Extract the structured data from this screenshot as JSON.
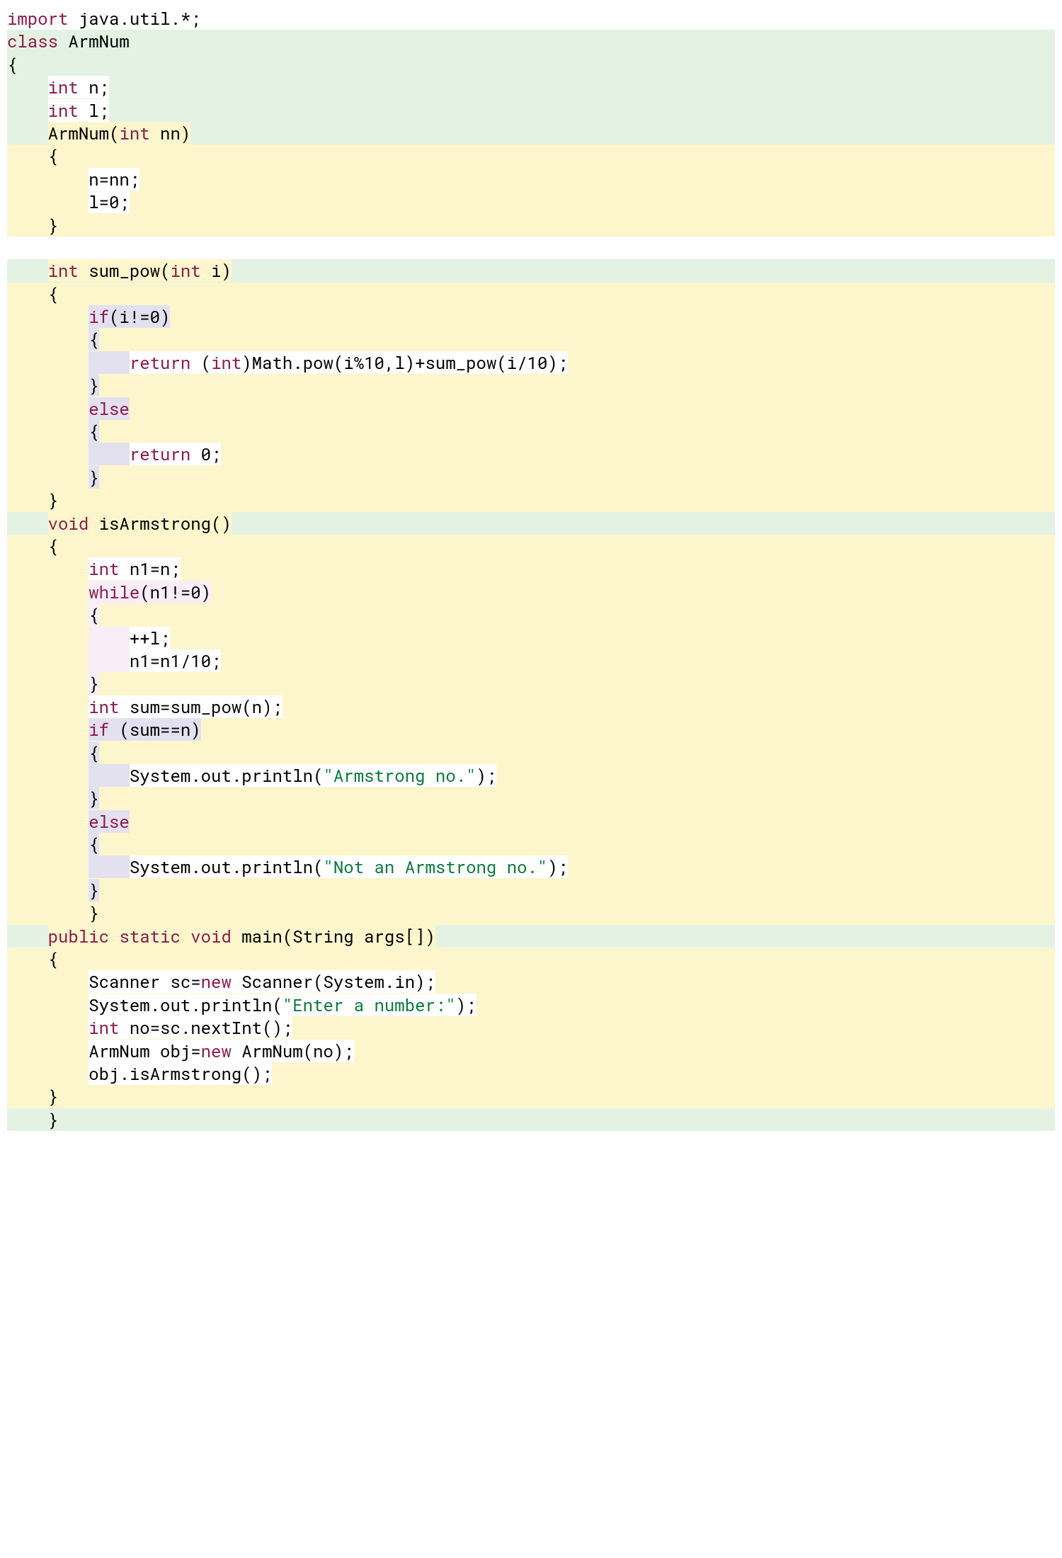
{
  "lines": [
    {
      "bg": "bg-white",
      "segs": [
        {
          "cls": "kw",
          "t": "import"
        },
        {
          "cls": "plain",
          "t": " java.util.*;"
        }
      ]
    },
    {
      "bg": "bg-green",
      "segs": [
        {
          "cls": "kw",
          "t": "class"
        },
        {
          "cls": "plain",
          "t": " ArmNum"
        }
      ]
    },
    {
      "bg": "bg-green",
      "segs": [
        {
          "cls": "plain",
          "t": "{"
        }
      ]
    },
    {
      "bg": "bg-green",
      "segs": [
        {
          "cls": "plain",
          "t": "    ",
          "bg": "bg-green"
        },
        {
          "cls": "kw",
          "t": "int",
          "bg": "bg-white"
        },
        {
          "cls": "plain",
          "t": " n;",
          "bg": "bg-white"
        }
      ]
    },
    {
      "bg": "bg-green",
      "segs": [
        {
          "cls": "plain",
          "t": "    ",
          "bg": "bg-green"
        },
        {
          "cls": "kw",
          "t": "int",
          "bg": "bg-white"
        },
        {
          "cls": "plain",
          "t": " l;",
          "bg": "bg-white"
        }
      ]
    },
    {
      "bg": "bg-green",
      "segs": [
        {
          "cls": "plain",
          "t": "    ",
          "bg": "bg-green"
        },
        {
          "cls": "plain",
          "t": "ArmNum(",
          "bg": "bg-yellow"
        },
        {
          "cls": "kw",
          "t": "int",
          "bg": "bg-yellow"
        },
        {
          "cls": "plain",
          "t": " nn)",
          "bg": "bg-yellow"
        }
      ]
    },
    {
      "bg": "bg-yellow",
      "segs": [
        {
          "cls": "plain",
          "t": "    {"
        }
      ]
    },
    {
      "bg": "bg-yellow",
      "segs": [
        {
          "cls": "plain",
          "t": "        ",
          "bg": "bg-yellow"
        },
        {
          "cls": "plain",
          "t": "n=nn;",
          "bg": "bg-white"
        }
      ]
    },
    {
      "bg": "bg-yellow",
      "segs": [
        {
          "cls": "plain",
          "t": "        ",
          "bg": "bg-yellow"
        },
        {
          "cls": "plain",
          "t": "l=0;",
          "bg": "bg-white"
        }
      ]
    },
    {
      "bg": "bg-yellow",
      "segs": [
        {
          "cls": "plain",
          "t": "    }"
        }
      ]
    },
    {
      "bg": "bg-white",
      "segs": [
        {
          "cls": "plain",
          "t": " "
        }
      ]
    },
    {
      "bg": "bg-green",
      "segs": [
        {
          "cls": "plain",
          "t": "    ",
          "bg": "bg-green"
        },
        {
          "cls": "kw",
          "t": "int",
          "bg": "bg-yellow"
        },
        {
          "cls": "plain",
          "t": " sum_pow(",
          "bg": "bg-yellow"
        },
        {
          "cls": "kw",
          "t": "int",
          "bg": "bg-yellow"
        },
        {
          "cls": "plain",
          "t": " i)",
          "bg": "bg-yellow"
        }
      ]
    },
    {
      "bg": "bg-yellow",
      "segs": [
        {
          "cls": "plain",
          "t": "    {"
        }
      ]
    },
    {
      "bg": "bg-yellow",
      "segs": [
        {
          "cls": "plain",
          "t": "        ",
          "bg": "bg-yellow"
        },
        {
          "cls": "kw",
          "t": "if",
          "bg": "bg-purple"
        },
        {
          "cls": "plain",
          "t": "(i!=0)",
          "bg": "bg-purple"
        }
      ]
    },
    {
      "bg": "bg-yellow",
      "segs": [
        {
          "cls": "plain",
          "t": "        ",
          "bg": "bg-yellow"
        },
        {
          "cls": "plain",
          "t": "{",
          "bg": "bg-purple"
        }
      ]
    },
    {
      "bg": "bg-yellow",
      "segs": [
        {
          "cls": "plain",
          "t": "        ",
          "bg": "bg-yellow"
        },
        {
          "cls": "plain",
          "t": "    ",
          "bg": "bg-purple"
        },
        {
          "cls": "kw",
          "t": "return",
          "bg": "bg-white"
        },
        {
          "cls": "plain",
          "t": " (",
          "bg": "bg-white"
        },
        {
          "cls": "kw",
          "t": "int",
          "bg": "bg-white"
        },
        {
          "cls": "plain",
          "t": ")Math.pow(i%10,l)+sum_pow(i/10);",
          "bg": "bg-white"
        }
      ]
    },
    {
      "bg": "bg-yellow",
      "segs": [
        {
          "cls": "plain",
          "t": "        ",
          "bg": "bg-yellow"
        },
        {
          "cls": "plain",
          "t": "}",
          "bg": "bg-purple"
        }
      ]
    },
    {
      "bg": "bg-yellow",
      "segs": [
        {
          "cls": "plain",
          "t": "        ",
          "bg": "bg-yellow"
        },
        {
          "cls": "kw",
          "t": "else",
          "bg": "bg-purple"
        }
      ]
    },
    {
      "bg": "bg-yellow",
      "segs": [
        {
          "cls": "plain",
          "t": "        ",
          "bg": "bg-yellow"
        },
        {
          "cls": "plain",
          "t": "{",
          "bg": "bg-purple"
        }
      ]
    },
    {
      "bg": "bg-yellow",
      "segs": [
        {
          "cls": "plain",
          "t": "        ",
          "bg": "bg-yellow"
        },
        {
          "cls": "plain",
          "t": "    ",
          "bg": "bg-purple"
        },
        {
          "cls": "kw",
          "t": "return",
          "bg": "bg-white"
        },
        {
          "cls": "plain",
          "t": " 0;",
          "bg": "bg-white"
        }
      ]
    },
    {
      "bg": "bg-yellow",
      "segs": [
        {
          "cls": "plain",
          "t": "        ",
          "bg": "bg-yellow"
        },
        {
          "cls": "plain",
          "t": "}",
          "bg": "bg-purple"
        }
      ]
    },
    {
      "bg": "bg-yellow",
      "segs": [
        {
          "cls": "plain",
          "t": "    }"
        }
      ]
    },
    {
      "bg": "bg-green",
      "segs": [
        {
          "cls": "plain",
          "t": "    ",
          "bg": "bg-green"
        },
        {
          "cls": "kw",
          "t": "void",
          "bg": "bg-yellow"
        },
        {
          "cls": "plain",
          "t": " isArmstrong()",
          "bg": "bg-yellow"
        }
      ]
    },
    {
      "bg": "bg-yellow",
      "segs": [
        {
          "cls": "plain",
          "t": "    {"
        }
      ]
    },
    {
      "bg": "bg-yellow",
      "segs": [
        {
          "cls": "plain",
          "t": "        ",
          "bg": "bg-yellow"
        },
        {
          "cls": "kw",
          "t": "int",
          "bg": "bg-white"
        },
        {
          "cls": "plain",
          "t": " n1=n;",
          "bg": "bg-white"
        }
      ]
    },
    {
      "bg": "bg-yellow",
      "segs": [
        {
          "cls": "plain",
          "t": "        ",
          "bg": "bg-yellow"
        },
        {
          "cls": "kw",
          "t": "while",
          "bg": "bg-pink"
        },
        {
          "cls": "plain",
          "t": "(n1!=0)",
          "bg": "bg-pink"
        }
      ]
    },
    {
      "bg": "bg-yellow",
      "segs": [
        {
          "cls": "plain",
          "t": "        ",
          "bg": "bg-yellow"
        },
        {
          "cls": "plain",
          "t": "{",
          "bg": "bg-pink"
        }
      ]
    },
    {
      "bg": "bg-yellow",
      "segs": [
        {
          "cls": "plain",
          "t": "        ",
          "bg": "bg-yellow"
        },
        {
          "cls": "plain",
          "t": "    ",
          "bg": "bg-pink"
        },
        {
          "cls": "plain",
          "t": "++l;",
          "bg": "bg-white"
        }
      ]
    },
    {
      "bg": "bg-yellow",
      "segs": [
        {
          "cls": "plain",
          "t": "        ",
          "bg": "bg-yellow"
        },
        {
          "cls": "plain",
          "t": "    ",
          "bg": "bg-pink"
        },
        {
          "cls": "plain",
          "t": "n1=n1/10;",
          "bg": "bg-white"
        }
      ]
    },
    {
      "bg": "bg-yellow",
      "segs": [
        {
          "cls": "plain",
          "t": "        ",
          "bg": "bg-yellow"
        },
        {
          "cls": "plain",
          "t": "}",
          "bg": "bg-pink"
        }
      ]
    },
    {
      "bg": "bg-yellow",
      "segs": [
        {
          "cls": "plain",
          "t": "        ",
          "bg": "bg-yellow"
        },
        {
          "cls": "kw",
          "t": "int",
          "bg": "bg-white"
        },
        {
          "cls": "plain",
          "t": " sum=sum_pow(n);",
          "bg": "bg-white"
        }
      ]
    },
    {
      "bg": "bg-yellow",
      "segs": [
        {
          "cls": "plain",
          "t": "        ",
          "bg": "bg-yellow"
        },
        {
          "cls": "kw",
          "t": "if",
          "bg": "bg-purple"
        },
        {
          "cls": "plain",
          "t": " (sum==n)",
          "bg": "bg-purple"
        }
      ]
    },
    {
      "bg": "bg-yellow",
      "segs": [
        {
          "cls": "plain",
          "t": "        ",
          "bg": "bg-yellow"
        },
        {
          "cls": "plain",
          "t": "{",
          "bg": "bg-purple"
        }
      ]
    },
    {
      "bg": "bg-yellow",
      "segs": [
        {
          "cls": "plain",
          "t": "        ",
          "bg": "bg-yellow"
        },
        {
          "cls": "plain",
          "t": "    ",
          "bg": "bg-purple"
        },
        {
          "cls": "plain",
          "t": "System.out.println(",
          "bg": "bg-white"
        },
        {
          "cls": "str",
          "t": "\"Armstrong no.\"",
          "bg": "bg-white"
        },
        {
          "cls": "plain",
          "t": ");",
          "bg": "bg-white"
        }
      ]
    },
    {
      "bg": "bg-yellow",
      "segs": [
        {
          "cls": "plain",
          "t": "        ",
          "bg": "bg-yellow"
        },
        {
          "cls": "plain",
          "t": "}",
          "bg": "bg-purple"
        }
      ]
    },
    {
      "bg": "bg-yellow",
      "segs": [
        {
          "cls": "plain",
          "t": "        ",
          "bg": "bg-yellow"
        },
        {
          "cls": "kw",
          "t": "else",
          "bg": "bg-purple"
        }
      ]
    },
    {
      "bg": "bg-yellow",
      "segs": [
        {
          "cls": "plain",
          "t": "        ",
          "bg": "bg-yellow"
        },
        {
          "cls": "plain",
          "t": "{",
          "bg": "bg-purple"
        }
      ]
    },
    {
      "bg": "bg-yellow",
      "segs": [
        {
          "cls": "plain",
          "t": "        ",
          "bg": "bg-yellow"
        },
        {
          "cls": "plain",
          "t": "    ",
          "bg": "bg-purple"
        },
        {
          "cls": "plain",
          "t": "System.out.println(",
          "bg": "bg-white"
        },
        {
          "cls": "str",
          "t": "\"Not an Armstrong no.\"",
          "bg": "bg-white"
        },
        {
          "cls": "plain",
          "t": ");",
          "bg": "bg-white"
        }
      ]
    },
    {
      "bg": "bg-yellow",
      "segs": [
        {
          "cls": "plain",
          "t": "        ",
          "bg": "bg-yellow"
        },
        {
          "cls": "plain",
          "t": "}",
          "bg": "bg-purple"
        }
      ]
    },
    {
      "bg": "bg-yellow",
      "segs": [
        {
          "cls": "plain",
          "t": "        }"
        }
      ]
    },
    {
      "bg": "bg-green",
      "segs": [
        {
          "cls": "plain",
          "t": "    ",
          "bg": "bg-green"
        },
        {
          "cls": "kw",
          "t": "public",
          "bg": "bg-yellow"
        },
        {
          "cls": "plain",
          "t": " ",
          "bg": "bg-yellow"
        },
        {
          "cls": "kw",
          "t": "static",
          "bg": "bg-yellow"
        },
        {
          "cls": "plain",
          "t": " ",
          "bg": "bg-yellow"
        },
        {
          "cls": "kw",
          "t": "void",
          "bg": "bg-yellow"
        },
        {
          "cls": "plain",
          "t": " main(String args[])",
          "bg": "bg-yellow"
        }
      ]
    },
    {
      "bg": "bg-yellow",
      "segs": [
        {
          "cls": "plain",
          "t": "    {"
        }
      ]
    },
    {
      "bg": "bg-yellow",
      "segs": [
        {
          "cls": "plain",
          "t": "        ",
          "bg": "bg-yellow"
        },
        {
          "cls": "plain",
          "t": "Scanner sc=",
          "bg": "bg-white"
        },
        {
          "cls": "kw",
          "t": "new",
          "bg": "bg-white"
        },
        {
          "cls": "plain",
          "t": " Scanner(System.in);",
          "bg": "bg-white"
        }
      ]
    },
    {
      "bg": "bg-yellow",
      "segs": [
        {
          "cls": "plain",
          "t": "        ",
          "bg": "bg-yellow"
        },
        {
          "cls": "plain",
          "t": "System.out.println(",
          "bg": "bg-white"
        },
        {
          "cls": "str",
          "t": "\"Enter a number:\"",
          "bg": "bg-white"
        },
        {
          "cls": "plain",
          "t": ");",
          "bg": "bg-white"
        }
      ]
    },
    {
      "bg": "bg-yellow",
      "segs": [
        {
          "cls": "plain",
          "t": "        ",
          "bg": "bg-yellow"
        },
        {
          "cls": "kw",
          "t": "int",
          "bg": "bg-white"
        },
        {
          "cls": "plain",
          "t": " no=sc.nextInt();",
          "bg": "bg-white"
        }
      ]
    },
    {
      "bg": "bg-yellow",
      "segs": [
        {
          "cls": "plain",
          "t": "        ",
          "bg": "bg-yellow"
        },
        {
          "cls": "plain",
          "t": "ArmNum obj=",
          "bg": "bg-white"
        },
        {
          "cls": "kw",
          "t": "new",
          "bg": "bg-white"
        },
        {
          "cls": "plain",
          "t": " ArmNum(no);",
          "bg": "bg-white"
        }
      ]
    },
    {
      "bg": "bg-yellow",
      "segs": [
        {
          "cls": "plain",
          "t": "        ",
          "bg": "bg-yellow"
        },
        {
          "cls": "plain",
          "t": "obj.isArmstrong();",
          "bg": "bg-white"
        }
      ]
    },
    {
      "bg": "bg-yellow",
      "segs": [
        {
          "cls": "plain",
          "t": "    }"
        }
      ]
    },
    {
      "bg": "bg-green",
      "segs": [
        {
          "cls": "plain",
          "t": "    }"
        }
      ]
    }
  ]
}
